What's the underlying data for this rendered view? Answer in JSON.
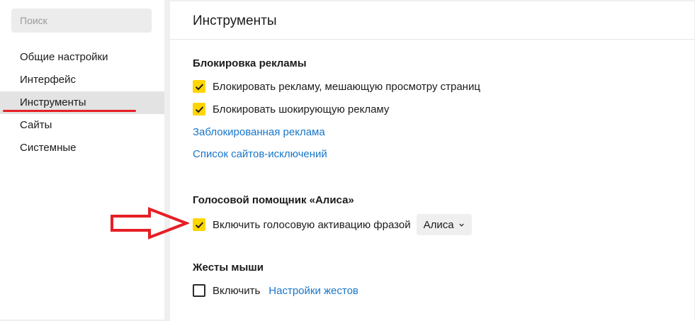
{
  "sidebar": {
    "search_placeholder": "Поиск",
    "items": [
      {
        "label": "Общие настройки"
      },
      {
        "label": "Интерфейс"
      },
      {
        "label": "Инструменты"
      },
      {
        "label": "Сайты"
      },
      {
        "label": "Системные"
      }
    ],
    "active_item": "Инструменты"
  },
  "main": {
    "title": "Инструменты",
    "ad_block": {
      "title": "Блокировка рекламы",
      "options": [
        {
          "label": "Блокировать рекламу, мешающую просмотру страниц",
          "checked": true
        },
        {
          "label": "Блокировать шокирующую рекламу",
          "checked": true
        }
      ],
      "links": [
        "Заблокированная реклама",
        "Список сайтов-исключений"
      ]
    },
    "alice": {
      "title": "Голосовой помощник «Алиса»",
      "option": {
        "label": "Включить голосовую активацию фразой",
        "checked": true
      },
      "phrase_select": {
        "value": "Алиса"
      }
    },
    "gestures": {
      "title": "Жесты мыши",
      "option": {
        "label": "Включить",
        "checked": false
      },
      "settings_link": "Настройки жестов"
    }
  },
  "colors": {
    "accent_checkbox": "#ffd500",
    "link": "#1976c9",
    "annotation_red": "#e61e25"
  },
  "icons": [
    "checkmark-icon",
    "chevron-down-icon",
    "annotation-arrow-icon"
  ]
}
